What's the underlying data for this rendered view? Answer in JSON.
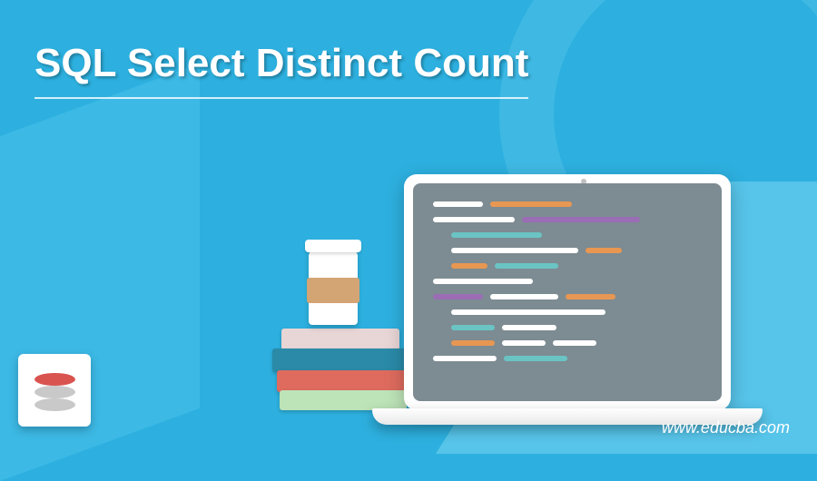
{
  "title": "SQL Select Distinct Count",
  "watermark": "www.educba.com",
  "logo": {
    "name": "sql-server-logo"
  },
  "illustration": {
    "books": [
      "book-pink",
      "book-blue",
      "book-red",
      "book-green"
    ],
    "cup": "coffee-cup",
    "laptop": "laptop-with-code"
  },
  "colors": {
    "background": "#2db0df",
    "title_text": "#ffffff"
  }
}
